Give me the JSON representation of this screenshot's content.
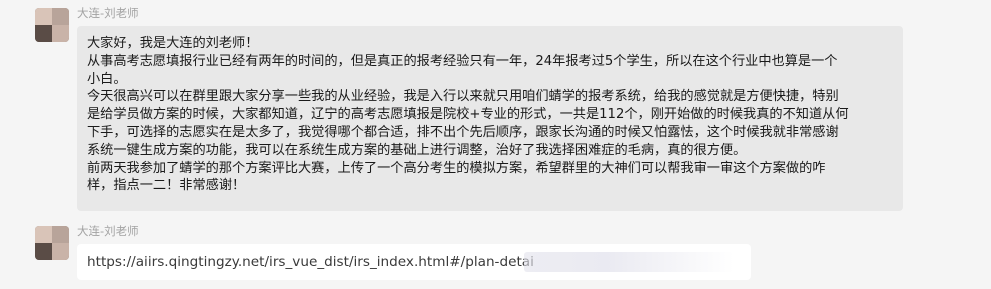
{
  "messages": [
    {
      "sender": "大连-刘老师",
      "lines": [
        "大家好，我是大连的刘老师！",
        "从事高考志愿填报行业已经有两年的时间的，但是真正的报考经验只有一年，24年报考过5个学生，所以在这个行业中也算是一个",
        "小白。",
        "今天很高兴可以在群里跟大家分享一些我的从业经验，我是入行以来就只用咱们蜻学的报考系统，给我的感觉就是方便快捷，特别",
        "是给学员做方案的时候，大家都知道，辽宁的高考志愿填报是院校+专业的形式，一共是112个，刚开始做的时候我真的不知道从何",
        "下手，可选择的志愿实在是太多了，我觉得哪个都合适，排不出个先后顺序，跟家长沟通的时候又怕露怯，这个时候我就非常感谢",
        "系统一键生成方案的功能，我可以在系统生成方案的基础上进行调整，治好了我选择困难症的毛病，真的很方便。",
        "前两天我参加了蜻学的那个方案评比大赛，上传了一个高分考生的模拟方案，希望群里的大神们可以帮我审一审这个方案做的咋",
        "样，指点一二！非常感谢！"
      ]
    },
    {
      "sender": "大连-刘老师",
      "link": "https://aiirs.qingtingzy.net/irs_vue_dist/irs_index.html#/plan-detai"
    }
  ]
}
